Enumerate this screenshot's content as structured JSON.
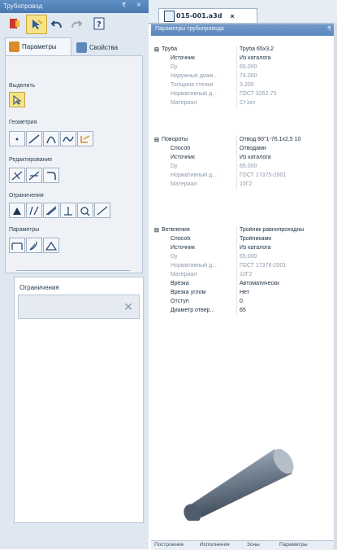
{
  "left_panel": {
    "title": "Трубопровод",
    "pin": "₹",
    "close": "×",
    "tabs": [
      {
        "label": "Параметры"
      },
      {
        "label": "Свойства"
      }
    ],
    "sections": {
      "select": "Выделить",
      "geometry": "Геометрия",
      "edit": "Редактирование",
      "constraints": "Ограничения",
      "params": "Параметры"
    },
    "constraints_box_title": "Ограничения",
    "delete_symbol": "✕"
  },
  "document_tab": {
    "label": "015-001.a3d",
    "close": "×"
  },
  "properties_panel": {
    "title": "Параметры трубопровода",
    "pin": "₹",
    "expander": "⊟",
    "groups": [
      {
        "name": "Труба",
        "value": "Труба 65х3,2",
        "rows": [
          {
            "key": "Источник",
            "value": "Из каталога",
            "dim": false
          },
          {
            "key": "Dy",
            "value": "65.000",
            "dim": true
          },
          {
            "key": "Наружный диам...",
            "value": "74.000",
            "dim": true
          },
          {
            "key": "Толщина стенки",
            "value": "3.200",
            "dim": true
          },
          {
            "key": "Нормативный д...",
            "value": "ГОСТ 3262-75",
            "dim": true
          },
          {
            "key": "Материал",
            "value": "Ст1кп",
            "dim": true
          }
        ]
      },
      {
        "name": "Повороты",
        "value": "Отвод 90°1-76.1х2,5 10",
        "rows": [
          {
            "key": "Способ",
            "value": "Отводами",
            "dim": false
          },
          {
            "key": "Источник",
            "value": "Из каталога",
            "dim": false
          },
          {
            "key": "Dy",
            "value": "65.000",
            "dim": true
          },
          {
            "key": "Нормативный д...",
            "value": "ГОСТ 17375-2001",
            "dim": true
          },
          {
            "key": "Материал",
            "value": "10Г2",
            "dim": true
          }
        ]
      },
      {
        "name": "Ветвления",
        "value": "Тройник равнопроходны",
        "rows": [
          {
            "key": "Способ",
            "value": "Тройниками",
            "dim": false
          },
          {
            "key": "Источник",
            "value": "Из каталога",
            "dim": false
          },
          {
            "key": "Dy",
            "value": "65.000",
            "dim": true
          },
          {
            "key": "Нормативный д...",
            "value": "ГОСТ 17376-2001",
            "dim": true
          },
          {
            "key": "Материал",
            "value": "10Г2",
            "dim": true
          },
          {
            "key": "Врезка",
            "value": "Автоматически",
            "dim": false
          },
          {
            "key": "Врезка углом",
            "value": "Нет",
            "dim": false
          },
          {
            "key": "Отступ",
            "value": "0",
            "dim": false
          },
          {
            "key": "Диаметр отвер...",
            "value": "65",
            "dim": false
          }
        ]
      }
    ]
  },
  "bottom_tabs": [
    "Построение",
    "Исполнения",
    "Зоны",
    "Параметры"
  ],
  "colors": {
    "title_bar": "#4a78b0",
    "panel_bg": "#dfe7f1",
    "pipe": "#7c8a99"
  }
}
